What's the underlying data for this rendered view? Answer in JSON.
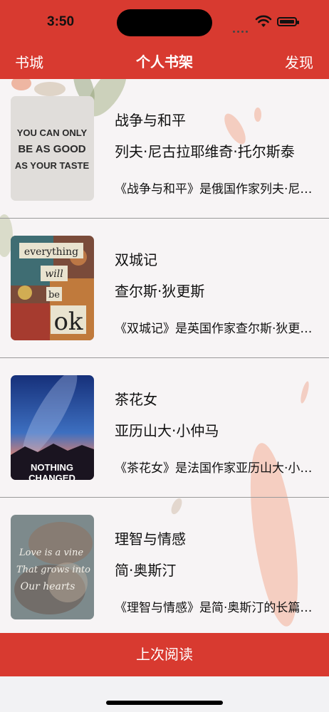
{
  "status": {
    "time": "3:50"
  },
  "nav": {
    "left": "书城",
    "title": "个人书架",
    "right": "发现"
  },
  "books": [
    {
      "title": "战争与和平",
      "author": "列夫·尼古拉耶维奇·托尔斯泰",
      "desc": "《战争与和平》是俄国作家列夫·尼古拉耶维奇·托尔斯泰创作的长篇小说",
      "cover_lines": [
        "YOU CAN ONLY",
        "BE AS GOOD",
        "AS YOUR TASTE"
      ]
    },
    {
      "title": "双城记",
      "author": "查尔斯·狄更斯",
      "desc": "《双城记》是英国作家查尔斯·狄更斯创作的长篇小说",
      "cover_lines": [
        "everything",
        "will",
        "be",
        "ok"
      ]
    },
    {
      "title": "茶花女",
      "author": "亚历山大·小仲马",
      "desc": "《茶花女》是法国作家亚历山大·小仲马创作的长篇小说",
      "cover_lines": [
        "NOTHING",
        "CHANGED"
      ]
    },
    {
      "title": "理智与情感",
      "author": "简·奥斯汀",
      "desc": "《理智与情感》是简·奥斯汀的长篇小说",
      "cover_lines": [
        "Love is a vine",
        "That grows into",
        "Our hearts"
      ]
    }
  ],
  "bottom": {
    "label": "上次阅读"
  },
  "colors": {
    "accent": "#d83a30"
  }
}
